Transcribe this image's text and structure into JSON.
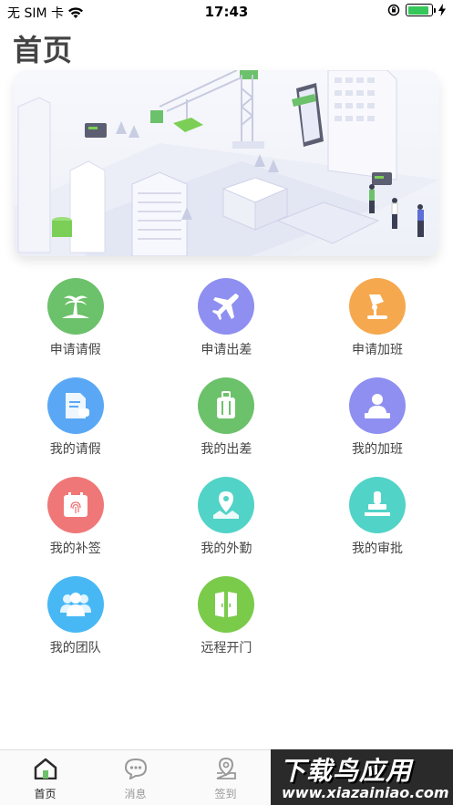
{
  "status_bar": {
    "carrier": "无 SIM 卡",
    "time": "17:43",
    "battery_level": 0.9
  },
  "page": {
    "title": "首页"
  },
  "grid": {
    "items": [
      {
        "label": "申请请假",
        "icon": "beach-palm-icon",
        "color": "#6cc16b"
      },
      {
        "label": "申请出差",
        "icon": "airplane-icon",
        "color": "#8e8ff0"
      },
      {
        "label": "申请加班",
        "icon": "desk-lamp-icon",
        "color": "#f5a84e"
      },
      {
        "label": "我的请假",
        "icon": "leave-document-icon",
        "color": "#5aa8f5"
      },
      {
        "label": "我的出差",
        "icon": "luggage-icon",
        "color": "#6cc16b"
      },
      {
        "label": "我的加班",
        "icon": "worker-at-desk-icon",
        "color": "#8e8ff0"
      },
      {
        "label": "我的补签",
        "icon": "fingerprint-calendar-icon",
        "color": "#f07777"
      },
      {
        "label": "我的外勤",
        "icon": "map-pin-icon",
        "color": "#52d3c7"
      },
      {
        "label": "我的审批",
        "icon": "stamp-icon",
        "color": "#52d3c7"
      },
      {
        "label": "我的团队",
        "icon": "team-icon",
        "color": "#48b8f5"
      },
      {
        "label": "远程开门",
        "icon": "door-icon",
        "color": "#7acb4a"
      }
    ]
  },
  "tabbar": {
    "items": [
      {
        "label": "首页",
        "icon": "home-icon",
        "active": true
      },
      {
        "label": "消息",
        "icon": "message-icon",
        "active": false
      },
      {
        "label": "签到",
        "icon": "location-checkin-icon",
        "active": false
      }
    ]
  },
  "watermark": {
    "title": "下载鸟应用",
    "url": "www.xiazainiao.com"
  }
}
